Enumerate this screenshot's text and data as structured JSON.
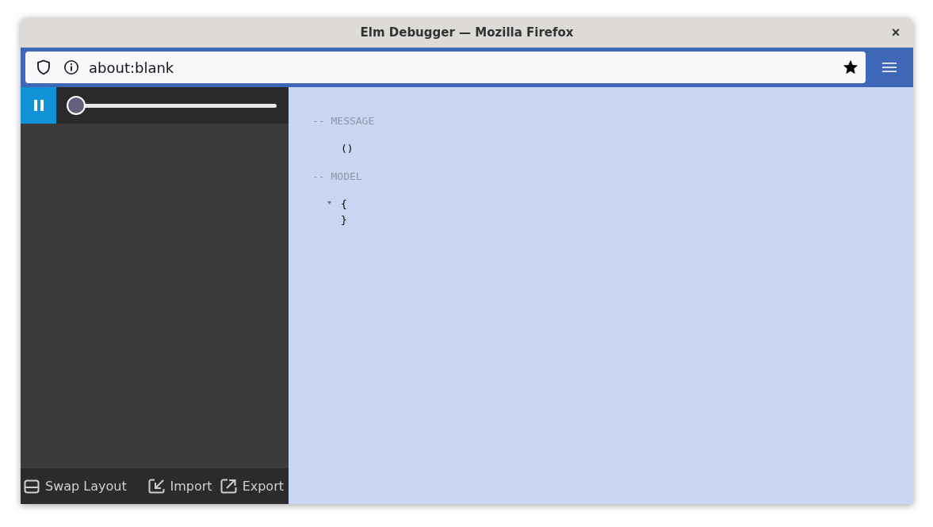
{
  "window": {
    "title": "Elm Debugger — Mozilla Firefox",
    "close": "×"
  },
  "address_bar": {
    "url": "about:blank"
  },
  "timeline": {
    "level": 0
  },
  "footer": [
    {
      "kind": "swap",
      "label": "Swap Layout"
    },
    {
      "kind": "import",
      "label": "Import"
    },
    {
      "kind": "export",
      "label": "Export"
    }
  ],
  "message": {
    "heading": "-- MESSAGE",
    "value": "()"
  },
  "model": {
    "heading": "-- MODEL",
    "expanded": true,
    "open": "{",
    "close": "}"
  }
}
